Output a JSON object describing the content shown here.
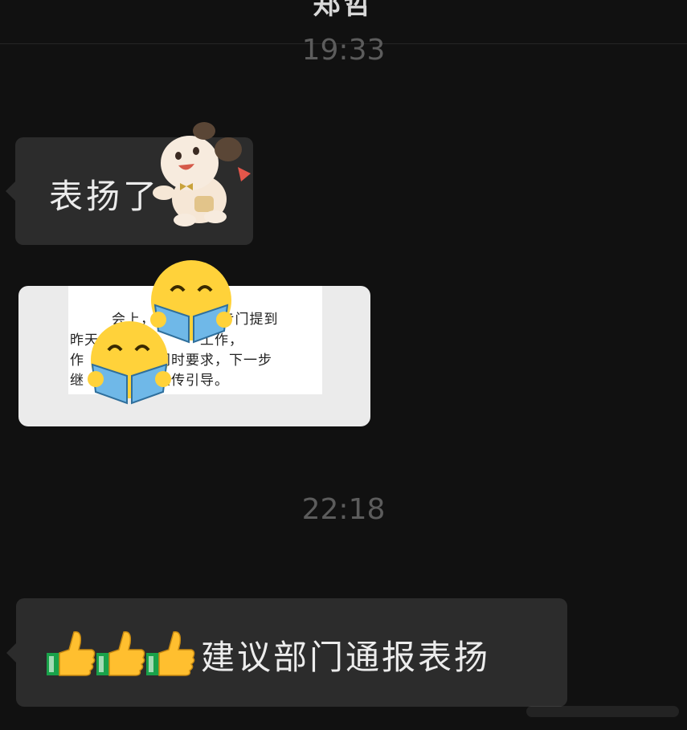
{
  "header": {
    "title": "郑哲"
  },
  "messages": [
    {
      "timestamp": "19:33",
      "bubble_text": "表扬了"
    },
    {
      "image_text": {
        "line1": "会上，",
        "line1b": "长专门提到",
        "line2": "昨天",
        "line2b": "工作，",
        "line3": "作",
        "line3b": "。同时要求，下一步",
        "line4": "继",
        "line4b": "宣传引导。"
      }
    },
    {
      "timestamp": "22:18",
      "bubble_text": "建议部门通报表扬"
    }
  ],
  "icons": [
    "thumbs-up-icon",
    "thumbs-up-icon",
    "thumbs-up-icon"
  ],
  "colors": {
    "background": "#111111",
    "bubble": "#2c2c2c",
    "timestamp": "#5c5c5c"
  }
}
